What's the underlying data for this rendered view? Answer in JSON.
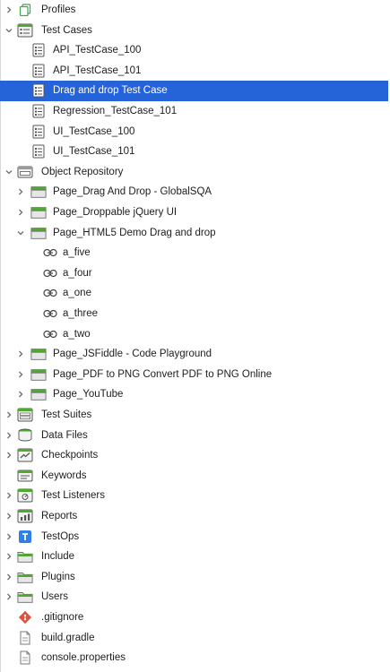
{
  "tree": [
    {
      "label": "Profiles",
      "icon": "profiles-icon",
      "depth": 0,
      "chevron": "collapsed",
      "name": "tree-item-profiles"
    },
    {
      "label": "Test Cases",
      "icon": "test-cases-icon",
      "depth": 0,
      "chevron": "expanded",
      "name": "tree-item-test-cases"
    },
    {
      "label": "API_TestCase_100",
      "icon": "test-case-icon",
      "depth": 1,
      "chevron": "none",
      "name": "tree-item-api-testcase-100"
    },
    {
      "label": "API_TestCase_101",
      "icon": "test-case-icon",
      "depth": 1,
      "chevron": "none",
      "name": "tree-item-api-testcase-101"
    },
    {
      "label": "Drag and drop Test Case",
      "icon": "test-case-icon",
      "depth": 1,
      "chevron": "none",
      "name": "tree-item-drag-and-drop-test-case",
      "selected": true
    },
    {
      "label": "Regression_TestCase_101",
      "icon": "test-case-icon",
      "depth": 1,
      "chevron": "none",
      "name": "tree-item-regression-testcase-101"
    },
    {
      "label": "UI_TestCase_100",
      "icon": "test-case-icon",
      "depth": 1,
      "chevron": "none",
      "name": "tree-item-ui-testcase-100"
    },
    {
      "label": "UI_TestCase_101",
      "icon": "test-case-icon",
      "depth": 1,
      "chevron": "none",
      "name": "tree-item-ui-testcase-101"
    },
    {
      "label": "Object Repository",
      "icon": "object-repository-icon",
      "depth": 0,
      "chevron": "expanded",
      "name": "tree-item-object-repository"
    },
    {
      "label": "Page_Drag And Drop - GlobalSQA",
      "icon": "page-folder-icon",
      "depth": 1,
      "chevron": "collapsed",
      "name": "tree-item-page-drag-and-drop-globalsqa"
    },
    {
      "label": "Page_Droppable  jQuery UI",
      "icon": "page-folder-icon",
      "depth": 1,
      "chevron": "collapsed",
      "name": "tree-item-page-droppable-jquery-ui"
    },
    {
      "label": "Page_HTML5 Demo Drag and drop",
      "icon": "page-folder-icon",
      "depth": 1,
      "chevron": "expanded",
      "name": "tree-item-page-html5-demo-drag-and-drop"
    },
    {
      "label": "a_five",
      "icon": "link-icon",
      "depth": 2,
      "chevron": "none",
      "name": "tree-item-a-five"
    },
    {
      "label": "a_four",
      "icon": "link-icon",
      "depth": 2,
      "chevron": "none",
      "name": "tree-item-a-four"
    },
    {
      "label": "a_one",
      "icon": "link-icon",
      "depth": 2,
      "chevron": "none",
      "name": "tree-item-a-one"
    },
    {
      "label": "a_three",
      "icon": "link-icon",
      "depth": 2,
      "chevron": "none",
      "name": "tree-item-a-three"
    },
    {
      "label": "a_two",
      "icon": "link-icon",
      "depth": 2,
      "chevron": "none",
      "name": "tree-item-a-two"
    },
    {
      "label": "Page_JSFiddle - Code Playground",
      "icon": "page-folder-icon",
      "depth": 1,
      "chevron": "collapsed",
      "name": "tree-item-page-jsfiddle-code-playground"
    },
    {
      "label": "Page_PDF to PNG  Convert PDF to PNG Online",
      "icon": "page-folder-icon",
      "depth": 1,
      "chevron": "collapsed",
      "name": "tree-item-page-pdf-to-png"
    },
    {
      "label": "Page_YouTube",
      "icon": "page-folder-icon",
      "depth": 1,
      "chevron": "collapsed",
      "name": "tree-item-page-youtube"
    },
    {
      "label": "Test Suites",
      "icon": "test-suites-icon",
      "depth": 0,
      "chevron": "collapsed",
      "name": "tree-item-test-suites"
    },
    {
      "label": "Data Files",
      "icon": "data-files-icon",
      "depth": 0,
      "chevron": "collapsed",
      "name": "tree-item-data-files"
    },
    {
      "label": "Checkpoints",
      "icon": "checkpoints-icon",
      "depth": 0,
      "chevron": "collapsed",
      "name": "tree-item-checkpoints"
    },
    {
      "label": "Keywords",
      "icon": "keywords-icon",
      "depth": 0,
      "chevron": "none",
      "name": "tree-item-keywords"
    },
    {
      "label": "Test Listeners",
      "icon": "test-listeners-icon",
      "depth": 0,
      "chevron": "collapsed",
      "name": "tree-item-test-listeners"
    },
    {
      "label": "Reports",
      "icon": "reports-icon",
      "depth": 0,
      "chevron": "collapsed",
      "name": "tree-item-reports"
    },
    {
      "label": "TestOps",
      "icon": "testops-icon",
      "depth": 0,
      "chevron": "collapsed",
      "name": "tree-item-testops"
    },
    {
      "label": "Include",
      "icon": "folder-icon",
      "depth": 0,
      "chevron": "collapsed",
      "name": "tree-item-include"
    },
    {
      "label": "Plugins",
      "icon": "folder-icon",
      "depth": 0,
      "chevron": "collapsed",
      "name": "tree-item-plugins"
    },
    {
      "label": "Users",
      "icon": "folder-icon",
      "depth": 0,
      "chevron": "collapsed",
      "name": "tree-item-users"
    },
    {
      "label": ".gitignore",
      "icon": "git-icon",
      "depth": 0,
      "chevron": "none",
      "name": "tree-item-gitignore"
    },
    {
      "label": "build.gradle",
      "icon": "file-icon",
      "depth": 0,
      "chevron": "none",
      "name": "tree-item-build-gradle"
    },
    {
      "label": "console.properties",
      "icon": "file-icon",
      "depth": 0,
      "chevron": "none",
      "name": "tree-item-console-properties"
    }
  ],
  "colors": {
    "selection": "#2563d9",
    "folder_tab": "#4caa2f",
    "git": "#e0513a",
    "testops": "#2f80ed"
  }
}
